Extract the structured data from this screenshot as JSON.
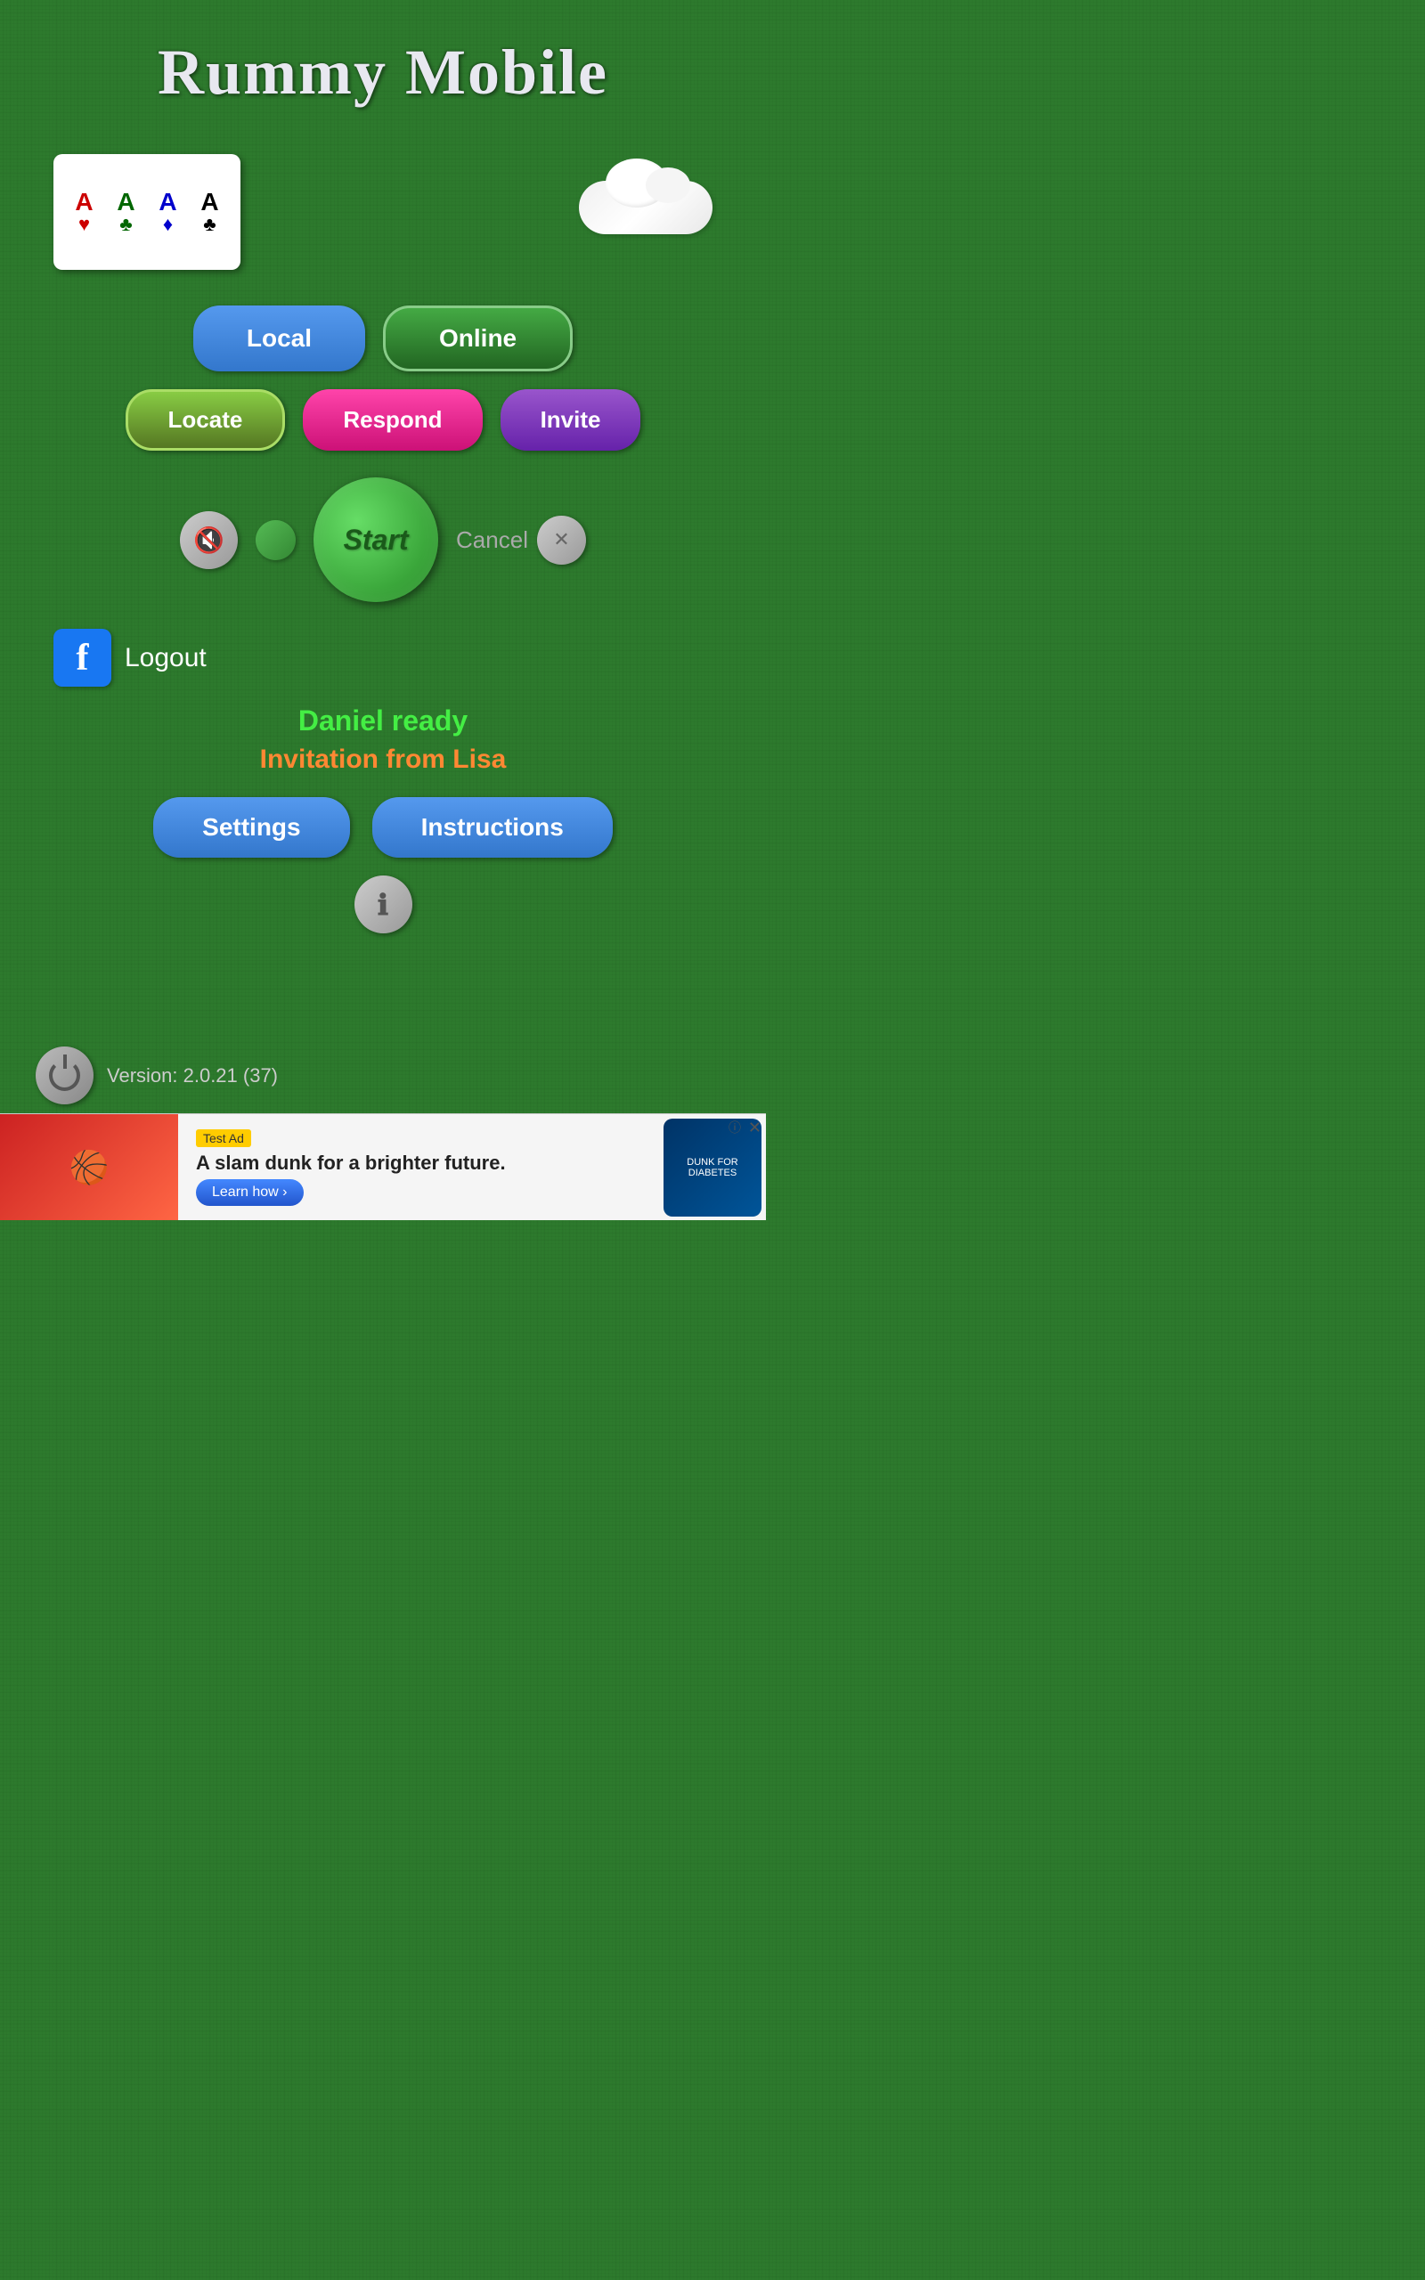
{
  "app": {
    "title": "Rummy Mobile"
  },
  "cards": {
    "card1": {
      "letter": "A",
      "suit": "♥",
      "color_class": "card-a"
    },
    "card2": {
      "letter": "A",
      "suit": "♣",
      "color_class": "card-b"
    },
    "card3": {
      "letter": "A",
      "suit": "♦",
      "color_class": "card-c"
    },
    "card4": {
      "letter": "A",
      "suit": "♣",
      "color_class": "card-d"
    }
  },
  "buttons": {
    "local": "Local",
    "online": "Online",
    "locate": "Locate",
    "respond": "Respond",
    "invite": "Invite",
    "start": "Start",
    "cancel": "Cancel",
    "settings": "Settings",
    "instructions": "Instructions",
    "logout": "Logout"
  },
  "status": {
    "daniel_ready": "Daniel ready",
    "invitation": "Invitation from Lisa"
  },
  "version": {
    "text": "Version: 2.0.21 (37)"
  },
  "ad": {
    "label": "Test Ad",
    "headline": "A slam dunk for a brighter future.",
    "cta": "Learn how ›",
    "logo_text": "DUNK FOR DIABETES"
  }
}
